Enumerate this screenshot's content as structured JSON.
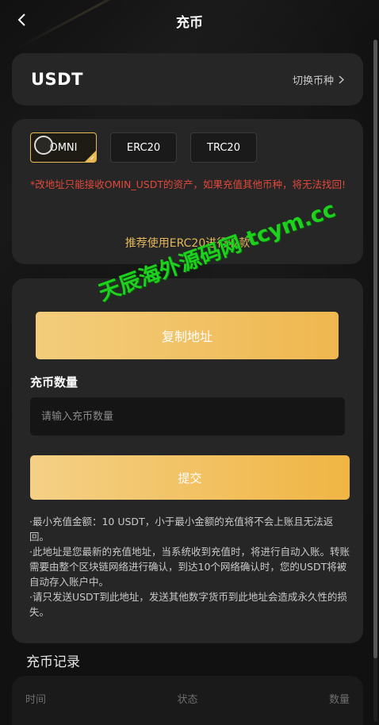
{
  "header": {
    "title": "充币"
  },
  "coin": {
    "name": "USDT",
    "switch_label": "切换币种"
  },
  "network": {
    "tabs": [
      {
        "label": "OMNI",
        "selected": true
      },
      {
        "label": "ERC20",
        "selected": false
      },
      {
        "label": "TRC20",
        "selected": false
      }
    ],
    "warning": "*改地址只能接收OMIN_USDT的资产，如果充值其他币种，将无法找回!",
    "recommend": "推荐使用ERC20进行收款"
  },
  "main": {
    "copy_button": "复制地址",
    "amount_label": "充币数量",
    "amount_placeholder": "请输入充币数量",
    "amount_value": "",
    "submit_button": "提交",
    "notes": [
      "·最小充值金额：10 USDT，小于最小金额的充值将不会上账且无法返回。",
      "·此地址是您最新的充值地址，当系统收到充值时，将进行自动入账。转账需要由整个区块链网络进行确认，到达10个网络确认时，您的USDT将被自动存入账户中。",
      "·请只发送USDT到此地址，发送其他数字货币到此地址会造成永久性的损失。"
    ]
  },
  "records": {
    "title": "充币记录",
    "columns": [
      "时间",
      "状态",
      "数量"
    ]
  },
  "watermark": "天辰海外源码网 tcym.cc",
  "colors": {
    "accent": "#efb74f",
    "warning": "#e0483a",
    "recommend": "#e2b75c",
    "card": "#262626",
    "background": "#111111",
    "watermark": "#1fd11f"
  }
}
